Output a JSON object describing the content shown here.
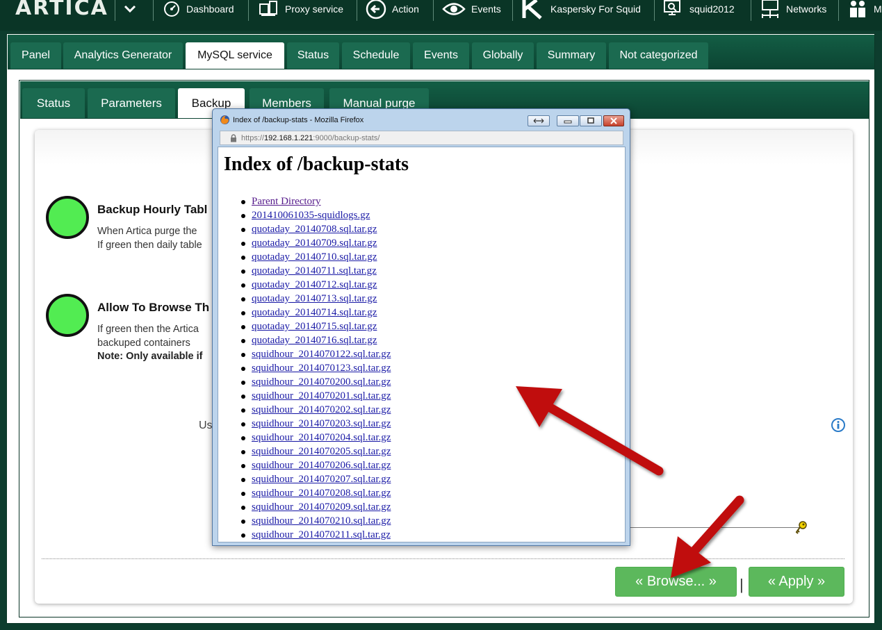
{
  "app": {
    "logo": "ARTICA"
  },
  "topnav": {
    "items": [
      {
        "label": "Dashboard",
        "icon": "dashboard-gauge-icon"
      },
      {
        "label": "Proxy service",
        "icon": "proxy-server-icon"
      },
      {
        "label": "Action",
        "icon": "back-arrow-icon"
      },
      {
        "label": "Events",
        "icon": "eye-icon"
      },
      {
        "label": "Kaspersky For Squid",
        "icon": "kaspersky-k-icon"
      },
      {
        "label": "squid2012",
        "icon": "monitor-search-icon"
      },
      {
        "label": "Networks",
        "icon": "network-icon"
      },
      {
        "label": "M",
        "icon": "users-icon"
      }
    ]
  },
  "outer_tabs": [
    "Panel",
    "Analytics Generator",
    "MySQL service",
    "Status",
    "Schedule",
    "Events",
    "Globally",
    "Summary",
    "Not categorized"
  ],
  "outer_active_tab": "MySQL service",
  "inner_tabs": [
    "Status",
    "Parameters",
    "Backup",
    "Members",
    "Manual purge"
  ],
  "inner_active_tab": "Backup",
  "options": [
    {
      "title": "Backup Hourly Tabl",
      "lines": [
        "When Artica purge the",
        "If green then daily table"
      ],
      "note": "",
      "status_color": "#52ec52"
    },
    {
      "title": "Allow To Browse Th",
      "lines": [
        "If green then the Artica",
        "backuped containers"
      ],
      "note": "Note: Only available if",
      "status_color": "#52ec52"
    }
  ],
  "truncated_label": "Us",
  "buttons": {
    "browse": "« Browse... »",
    "separator": "|",
    "apply": "« Apply »"
  },
  "popup": {
    "title": "Index of /backup-stats - Mozilla Firefox",
    "url_scheme": "https://",
    "url_host": "192.168.1.221",
    "url_rest": ":9000/backup-stats/",
    "heading": "Index of /backup-stats",
    "files": [
      "Parent Directory",
      "201410061035-squidlogs.gz",
      "quotaday_20140708.sql.tar.gz",
      "quotaday_20140709.sql.tar.gz",
      "quotaday_20140710.sql.tar.gz",
      "quotaday_20140711.sql.tar.gz",
      "quotaday_20140712.sql.tar.gz",
      "quotaday_20140713.sql.tar.gz",
      "quotaday_20140714.sql.tar.gz",
      "quotaday_20140715.sql.tar.gz",
      "quotaday_20140716.sql.tar.gz",
      "squidhour_2014070122.sql.tar.gz",
      "squidhour_2014070123.sql.tar.gz",
      "squidhour_2014070200.sql.tar.gz",
      "squidhour_2014070201.sql.tar.gz",
      "squidhour_2014070202.sql.tar.gz",
      "squidhour_2014070203.sql.tar.gz",
      "squidhour_2014070204.sql.tar.gz",
      "squidhour_2014070205.sql.tar.gz",
      "squidhour_2014070206.sql.tar.gz",
      "squidhour_2014070207.sql.tar.gz",
      "squidhour_2014070208.sql.tar.gz",
      "squidhour_2014070209.sql.tar.gz",
      "squidhour_2014070210.sql.tar.gz",
      "squidhour_2014070211.sql.tar.gz"
    ]
  },
  "colors": {
    "brand_dark_green": "#0a3526",
    "tab_green": "#1b6a50",
    "status_green": "#52ec52",
    "button_green": "#5cb85c",
    "annotation_red": "#c0100f",
    "link_blue": "#1a1aa6",
    "visited_purple": "#551a8b"
  }
}
